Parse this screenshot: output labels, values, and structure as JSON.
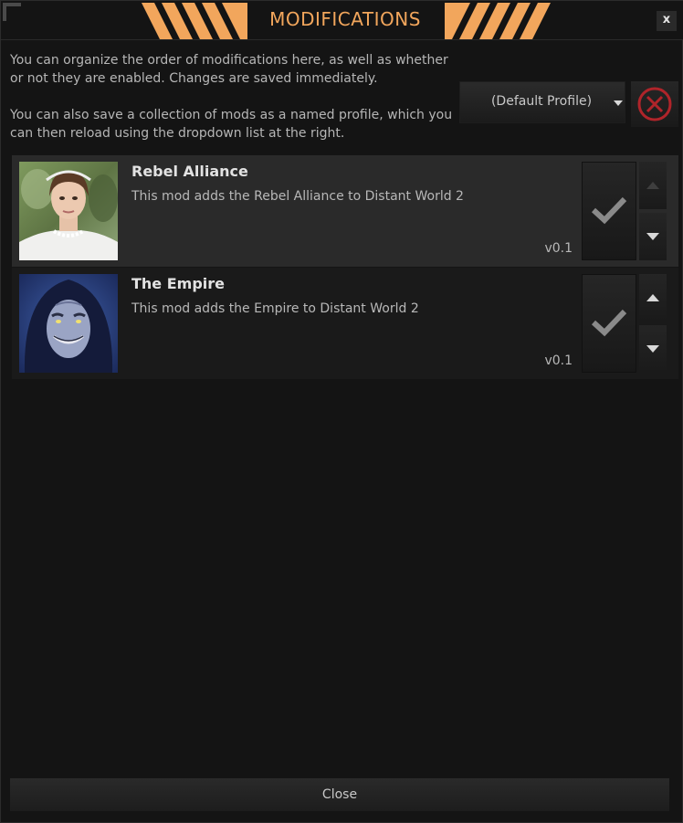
{
  "window": {
    "title": "MODIFICATIONS",
    "close_x": "x",
    "accent_color": "#f2a65c"
  },
  "intro": {
    "line1": "You can organize the order of modifications here, as well as whether or not they are enabled. Changes are saved immediately.",
    "line2": "You can also save a collection of mods as a named profile, which you can then reload using the dropdown list at the right."
  },
  "profile": {
    "selected": "(Default Profile)",
    "delete_icon": "delete-circle-icon",
    "delete_color": "#b0242a"
  },
  "mods": [
    {
      "name": "Rebel Alliance",
      "description": "This mod adds the Rebel Alliance to Distant World 2",
      "version": "v0.1",
      "enabled": true,
      "selected": true
    },
    {
      "name": "The Empire",
      "description": "This mod adds the Empire to Distant World 2",
      "version": "v0.1",
      "enabled": true,
      "selected": false
    }
  ],
  "footer": {
    "close_label": "Close"
  }
}
